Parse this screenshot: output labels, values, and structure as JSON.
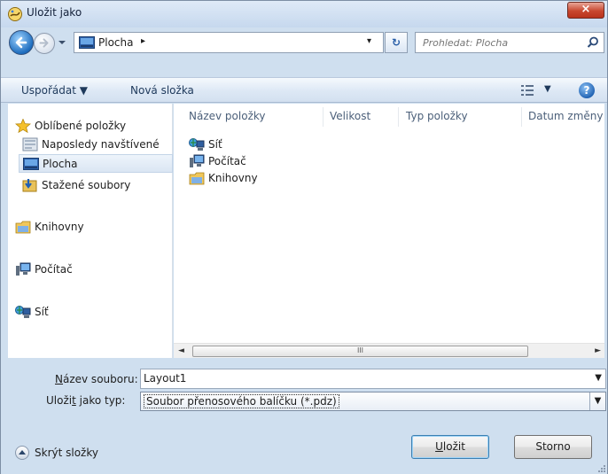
{
  "window": {
    "title": "Uložit jako",
    "close_label": "×"
  },
  "address": {
    "location": "Plocha",
    "chevron": "▸",
    "dropdown_glyph": "▾",
    "refresh_glyph": "↻"
  },
  "search": {
    "placeholder": "Prohledat: Plocha"
  },
  "toolbar": {
    "organize_label": "Uspořádat ▼",
    "new_folder_label": "Nová složka",
    "views_dropdown": "▼",
    "help_label": "?"
  },
  "navigation": {
    "favorites": {
      "label": "Oblíbené položky",
      "items": [
        {
          "label": "Naposledy navštívené"
        },
        {
          "label": "Plocha"
        },
        {
          "label": "Stažené soubory"
        }
      ]
    },
    "libraries": "Knihovny",
    "computer": "Počítač",
    "network": "Síť"
  },
  "columns": [
    "Název položky",
    "Velikost",
    "Typ položky",
    "Datum změny"
  ],
  "files": [
    {
      "name": "Síť"
    },
    {
      "name": "Počítač"
    },
    {
      "name": "Knihovny"
    }
  ],
  "scrollbar": {
    "left_arrow": "◄",
    "right_arrow": "►",
    "grip": "III"
  },
  "form": {
    "filename_label_u": "N",
    "filename_label_rest": "ázev souboru:",
    "filename_value": "Layout1",
    "filetype_label_pre": "Uloži",
    "filetype_label_u": "t",
    "filetype_label_rest": " jako typ:",
    "filetype_value": "Soubor přenosového balíčku (*.pdz)",
    "dropdown_glyph": "▼"
  },
  "footer": {
    "hide_folders_label": "Skrýt složky",
    "save_label_u": "U",
    "save_label_rest": "ložit",
    "cancel_label": "Storno"
  }
}
